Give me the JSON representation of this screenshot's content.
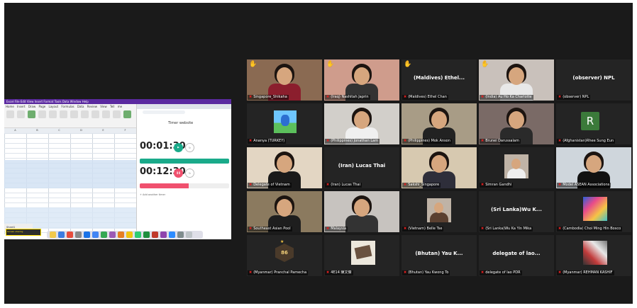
{
  "share": {
    "menu_text": "Excel  File  Edit  View  Insert  Format  Tools  Data  Window  Help",
    "ribbon_menus": "Home  Insert  Draw  Page Layout  Formulas  Data  Review  View  Tell me",
    "sheet_tab": "Sheet1",
    "notification": "Screen sharing",
    "timer_title": "Timer website",
    "timer1": {
      "value": "00:01:30",
      "progress": 1.0,
      "color": "#1aaa8a"
    },
    "timer2": {
      "value": "00:12:30",
      "progress": 0.55,
      "color": "#f0506e"
    },
    "add_timer": "+ Add another timer"
  },
  "participants": [
    {
      "label": "Singapore_Shikaha",
      "video": true,
      "hand": true,
      "bg": "#8a6a52",
      "shirt": "#8b1e2d"
    },
    {
      "label": "(Iraq) Nashitah Japrin",
      "video": true,
      "hand": true,
      "bg": "#cf9c8c",
      "shirt": "#333333"
    },
    {
      "label": "(Maldives) Ethel Chan",
      "name": "(Maldives)  Ethel...",
      "video": false,
      "hand": true
    },
    {
      "label": "(India) Au Ho Ka Charlotte",
      "video": true,
      "hand": true,
      "bg": "#c9c1bb",
      "shirt": "#e8e8e8"
    },
    {
      "label": "(observer) NPL",
      "name": "(observer) NPL",
      "video": false
    },
    {
      "label": "Ananya (TURKEY)",
      "video": false,
      "image": "cartoon"
    },
    {
      "label": "(Philippines) Jonathan Lam",
      "video": true,
      "bg": "#d2cfca",
      "shirt": "#f0f0f0"
    },
    {
      "label": "(Philippines) Mok Anson",
      "video": true,
      "bg": "#a89c86",
      "shirt": "#222222"
    },
    {
      "label": "Brunei Darussalam",
      "video": true,
      "bg": "#7a6a66",
      "shirt": "#2a2a2a"
    },
    {
      "label": "(Afghanistan)Rhee Sung Eun",
      "video": false,
      "avatar": "R"
    },
    {
      "label": "Delegate of Vietnam",
      "video": true,
      "bg": "#e3d6c3",
      "shirt": "#1a1a1a"
    },
    {
      "label": "(Iran) Lucas Thai",
      "name": "(Iran)  Lucas Thai",
      "video": false
    },
    {
      "label": "Sakshi_Singapore",
      "video": true,
      "speaking": true,
      "bg": "#d7c9b0",
      "shirt": "#2e2e3a"
    },
    {
      "label": "Simran Gandhi",
      "video": true,
      "bg": "#222222",
      "shirt": "#eeeeee",
      "small": true
    },
    {
      "label": "Model ASEAN Associations",
      "video": true,
      "bg": "#cfd6dc",
      "shirt": "#111111"
    },
    {
      "label": "Southeast Asian Pool",
      "video": true,
      "bg": "#8b7a5f",
      "shirt": "#1e1e1e"
    },
    {
      "label": "Malaysia",
      "video": true,
      "bg": "#c7c3bf",
      "shirt": "#333333"
    },
    {
      "label": "(Vietnam) Belle Tse",
      "video": true,
      "bg": "#222222",
      "shirt": "#5a4030",
      "small": true
    },
    {
      "label": "(Sri Lanka)Wu Ka Yin Mika",
      "name": "(Sri Lanka)Wu K...",
      "video": false
    },
    {
      "label": "(Cambodia) Choi Ming Hin Bosco",
      "video": false,
      "image": "art"
    },
    {
      "label": "(Myanmar) Pranchal Pamecha",
      "video": false,
      "image": "badge",
      "badge_text": "86"
    },
    {
      "label": "4E14 陳文傑",
      "video": false,
      "image": "box"
    },
    {
      "label": "(Bhutan) Yau Kwong To",
      "name": "(Bhutan) Yau K...",
      "video": false
    },
    {
      "label": "delegate of lao PDR",
      "name": "delegate of lao...",
      "video": false
    },
    {
      "label": "(Myanmar) REHMAN KASHIF",
      "video": false,
      "image": "art2"
    }
  ]
}
